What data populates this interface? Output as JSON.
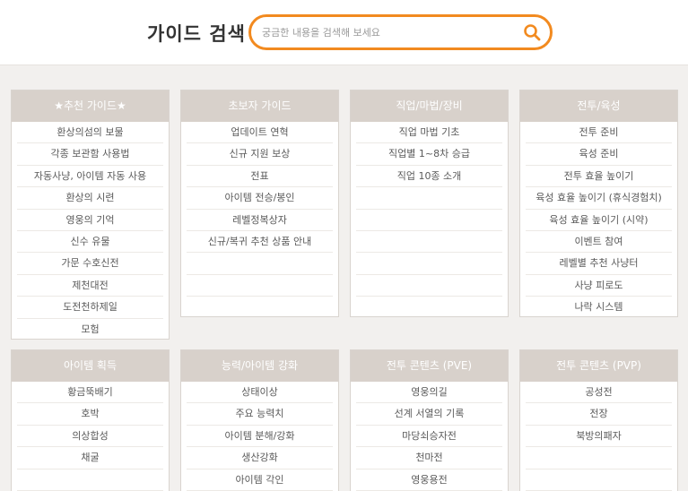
{
  "header": {
    "title": "가이드 검색",
    "search_placeholder": "궁금한 내용을 검색해 보세요"
  },
  "colors": {
    "accent": "#f28a1f",
    "card_header": "#d8d1cb",
    "background": "#f2f0ee"
  },
  "rows": [
    {
      "cards": [
        {
          "title": "★추천 가이드★",
          "items": [
            "환상의섬의 보물",
            "각종 보관함 사용법",
            "자동사냥, 아이템 자동 사용",
            "환상의 시련",
            "영웅의 기억",
            "신수 유물",
            "가문 수호신전",
            "제천대전",
            "도전천하제일",
            "모험"
          ]
        },
        {
          "title": "초보자 가이드",
          "items": [
            "업데이트 연혁",
            "신규 지원 보상",
            "전표",
            "아이템 전승/봉인",
            "레벨정복상자",
            "신규/복귀 추천 상품 안내"
          ]
        },
        {
          "title": "직업/마법/장비",
          "items": [
            "직업 마법 기초",
            "직업별 1~8차 승급",
            "직업 10종 소개"
          ]
        },
        {
          "title": "전투/육성",
          "items": [
            "전투 준비",
            "육성 준비",
            "전투 효율 높이기",
            "육성 효율 높이기 (휴식경험치)",
            "육성 효율 높이기 (시약)",
            "이벤트 참여",
            "레벨별 추천 사냥터",
            "사냥 피로도",
            "나락 시스템"
          ]
        }
      ]
    },
    {
      "cards": [
        {
          "title": "아이템 획득",
          "items": [
            "황금뚝배기",
            "호박",
            "의상합성",
            "채굴"
          ]
        },
        {
          "title": "능력/아이템 강화",
          "items": [
            "상태이상",
            "주요 능력치",
            "아이템 분해/강화",
            "생산강화",
            "아이템 각인"
          ]
        },
        {
          "title": "전투 콘텐츠 (PVE)",
          "items": [
            "영웅의길",
            "선계 서열의 기록",
            "마당쇠승자전",
            "천마전",
            "영웅용전"
          ]
        },
        {
          "title": "전투 콘텐츠 (PVP)",
          "items": [
            "공성전",
            "전장",
            "북방의패자"
          ]
        }
      ]
    }
  ]
}
